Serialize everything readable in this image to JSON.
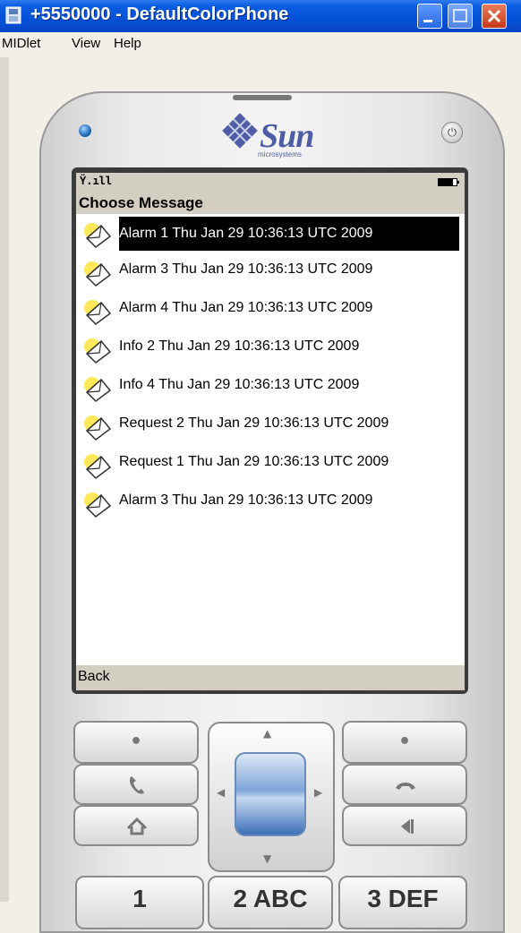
{
  "window": {
    "title": "+5550000 - DefaultColorPhone",
    "menu": [
      "MIDlet",
      "View",
      "Help"
    ]
  },
  "device": {
    "brand": "Sun",
    "brand_sub": "microsystems"
  },
  "screen": {
    "title": "Choose Message",
    "soft_key_left": "Back",
    "messages": [
      "Alarm 1 Thu Jan 29 10:36:13 UTC 2009",
      "Alarm 3 Thu Jan 29 10:36:13 UTC 2009",
      "Alarm 4 Thu Jan 29 10:36:13 UTC 2009",
      "Info 2 Thu Jan 29 10:36:13 UTC 2009",
      "Info 4 Thu Jan 29 10:36:13 UTC 2009",
      "Request 2 Thu Jan 29 10:36:13 UTC 2009",
      "Request 1 Thu Jan 29 10:36:13 UTC 2009",
      "Alarm 3 Thu Jan 29 10:36:13 UTC 2009"
    ],
    "selected_index": 0
  },
  "keypad": {
    "num_keys": [
      "1",
      "2 ABC",
      "3 DEF"
    ]
  },
  "colors": {
    "titlebar": "#0551d8",
    "screen_bar": "#d2cec2",
    "selection": "#000000"
  }
}
